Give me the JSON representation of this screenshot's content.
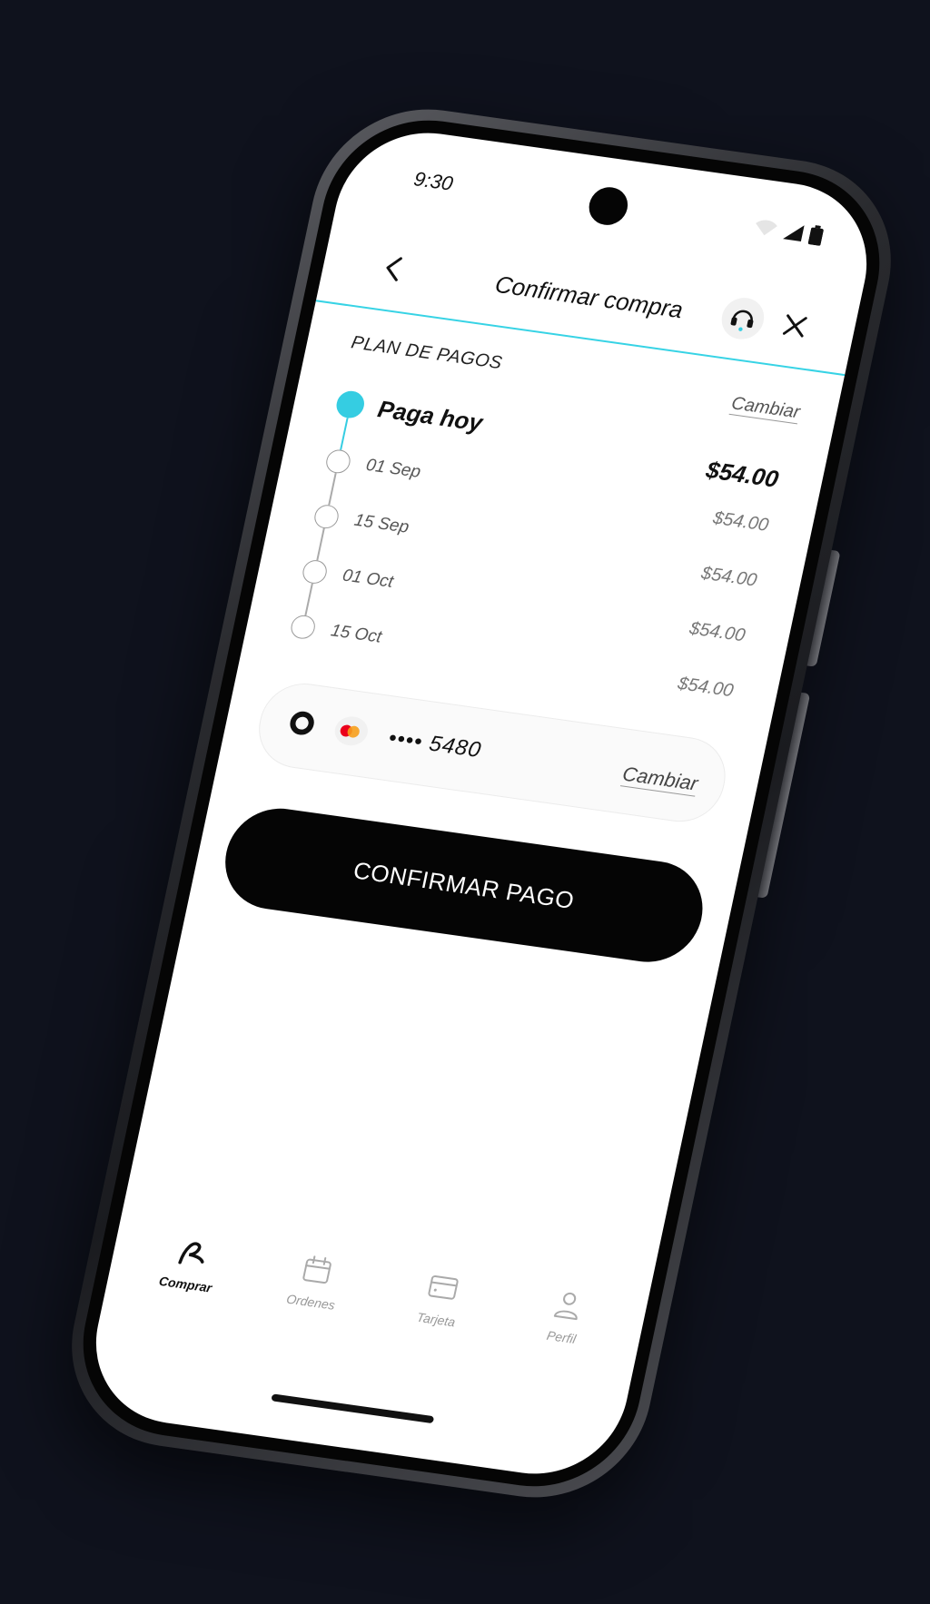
{
  "status_bar": {
    "time": "9:30"
  },
  "header": {
    "title": "Confirmar compra",
    "icons": [
      "chevron-left-icon",
      "headset-icon",
      "close-icon"
    ]
  },
  "plan": {
    "title": "PLAN DE PAGOS",
    "change_label": "Cambiar",
    "rows": [
      {
        "date": "Paga hoy",
        "amount": "$54.00"
      },
      {
        "date": "01 Sep",
        "amount": "$54.00"
      },
      {
        "date": "15 Sep",
        "amount": "$54.00"
      },
      {
        "date": "01 Oct",
        "amount": "$54.00"
      },
      {
        "date": "15 Oct",
        "amount": "$54.00"
      }
    ]
  },
  "payment_method": {
    "card_number": "•••• 5480",
    "change_label": "Cambiar",
    "icon": "mastercard-icon"
  },
  "confirm_button": {
    "label": "CONFIRMAR PAGO"
  },
  "tabbar": {
    "items": [
      {
        "label": "Comprar",
        "icon": "comprar-logo-icon"
      },
      {
        "label": "Ordenes",
        "icon": "calendar-icon"
      },
      {
        "label": "Tarjeta",
        "icon": "card-icon"
      },
      {
        "label": "Perfil",
        "icon": "person-icon"
      }
    ]
  },
  "colors": {
    "accent": "#35cde2",
    "background": "#0f121d",
    "button": "#050505",
    "mastercard_red": "#eb001b",
    "mastercard_orange": "#f79e1b"
  }
}
